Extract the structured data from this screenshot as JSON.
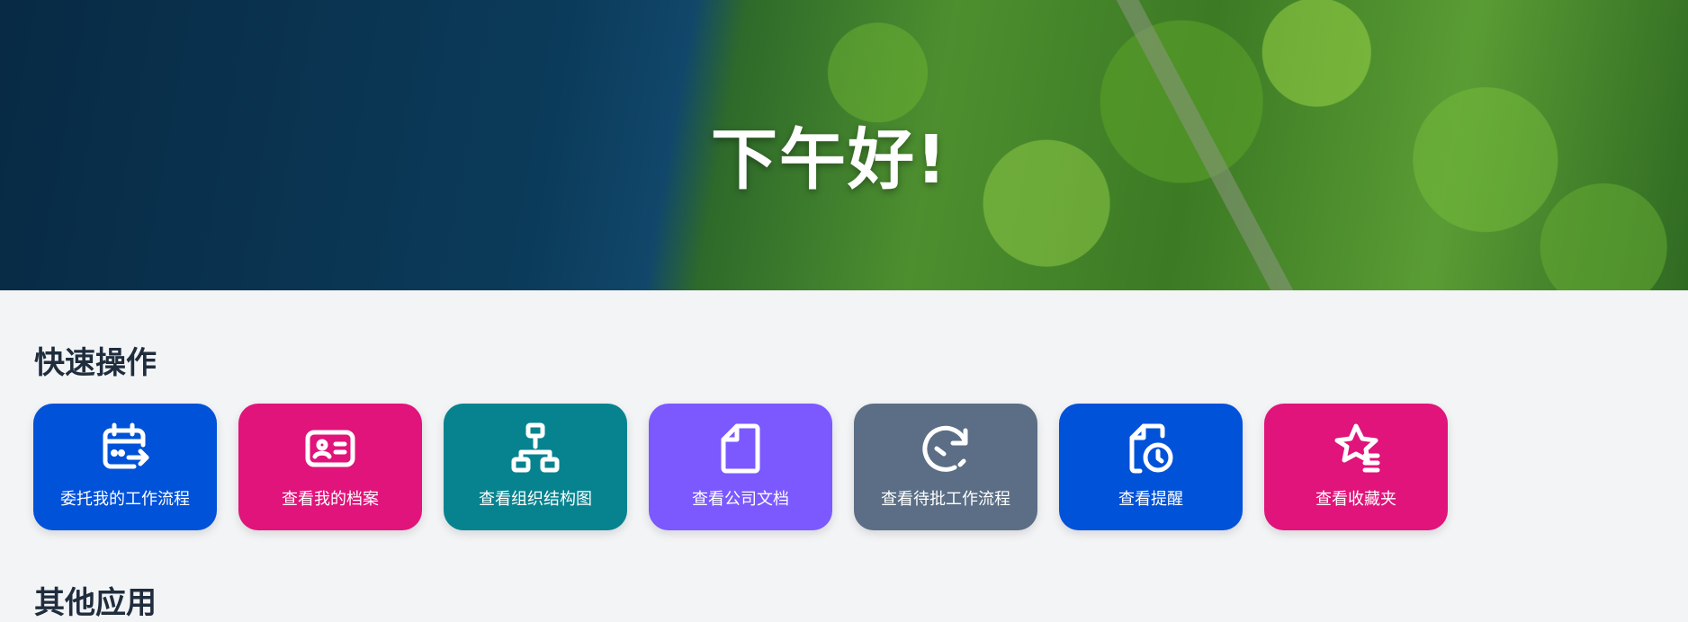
{
  "hero": {
    "greeting": "下午好!"
  },
  "quick_actions": {
    "title": "快速操作",
    "items": [
      {
        "label": "委托我的工作流程",
        "icon": "calendar-arrow-icon",
        "color": "#0052d9"
      },
      {
        "label": "查看我的档案",
        "icon": "id-card-icon",
        "color": "#e0147a"
      },
      {
        "label": "查看组织结构图",
        "icon": "org-chart-icon",
        "color": "#07838f"
      },
      {
        "label": "查看公司文档",
        "icon": "document-icon",
        "color": "#7b59ff"
      },
      {
        "label": "查看待批工作流程",
        "icon": "refresh-check-icon",
        "color": "#5b6e85"
      },
      {
        "label": "查看提醒",
        "icon": "file-clock-icon",
        "color": "#0052d9"
      },
      {
        "label": "查看收藏夹",
        "icon": "star-list-icon",
        "color": "#e0147a"
      }
    ]
  },
  "other_apps": {
    "title": "其他应用"
  }
}
